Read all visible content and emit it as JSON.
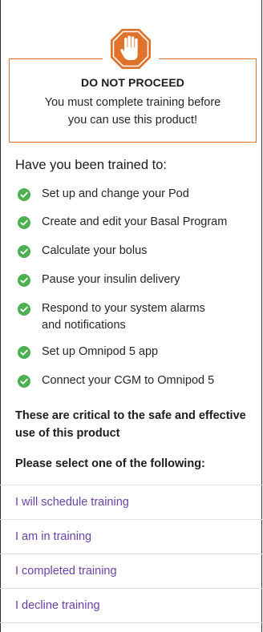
{
  "warning": {
    "title": "DO NOT PROCEED",
    "body_line1": "You must complete training before",
    "body_line2": "you can use this product!",
    "icon": "stop-hand-icon"
  },
  "training": {
    "heading": "Have you been trained to:",
    "items": [
      {
        "line1": "Set up and change your Pod",
        "line2": ""
      },
      {
        "line1": "Create and edit your Basal Program",
        "line2": ""
      },
      {
        "line1": "Calculate your bolus",
        "line2": ""
      },
      {
        "line1": "Pause your insulin delivery",
        "line2": ""
      },
      {
        "line1": "Respond to your system alarms",
        "line2": "and notifications"
      },
      {
        "line1": "Set up Omnipod 5 app",
        "line2": ""
      },
      {
        "line1": "Connect your CGM to Omnipod 5",
        "line2": ""
      }
    ]
  },
  "note": {
    "line1": "These are critical to the safe and effective",
    "line2": "use of this product"
  },
  "prompt": "Please select one of the following:",
  "options": [
    "I will schedule training",
    "I am in training",
    "I completed training",
    "I decline training"
  ],
  "colors": {
    "accent_orange": "#e0732b",
    "check_green": "#4caf50",
    "link_purple": "#6b3fa8"
  }
}
